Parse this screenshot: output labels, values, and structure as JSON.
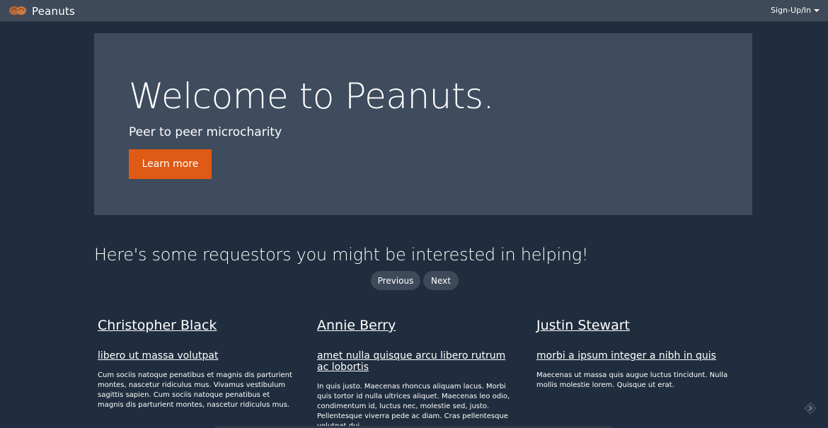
{
  "navbar": {
    "brand_name": "Peanuts",
    "logo_icon": "peanut-icon",
    "auth_label": "Sign-Up/In"
  },
  "hero": {
    "title": "Welcome to Peanuts.",
    "subtitle": "Peer to peer microcharity",
    "button_label": "Learn more"
  },
  "requestors": {
    "heading": "Here's some requestors you might be interested in helping!",
    "previous_label": "Previous",
    "next_label": "Next",
    "cards": [
      {
        "name": "Christopher Black",
        "title": "libero ut massa volutpat",
        "description": "Cum sociis natoque penatibus et magnis dis parturient montes, nascetur ridiculus mus. Vivamus vestibulum sagittis sapien. Cum sociis natoque penatibus et magnis dis parturient montes, nascetur ridiculus mus."
      },
      {
        "name": "Annie Berry",
        "title": "amet nulla quisque arcu libero rutrum ac lobortis",
        "description": "In quis justo. Maecenas rhoncus aliquam lacus. Morbi quis tortor id nulla ultrices aliquet. Maecenas leo odio, condimentum id, luctus nec, molestie sed, justo. Pellentesque viverra pede ac diam. Cras pellentesque volutpat dui."
      },
      {
        "name": "Justin Stewart",
        "title": "morbi a ipsum integer a nibh in quis",
        "description": "Maecenas ut massa quis augue luctus tincidunt. Nulla mollis molestie lorem. Quisque ut erat."
      }
    ]
  },
  "colors": {
    "background": "#1f2d3e",
    "navbar": "#3e4a59",
    "hero": "#3e4c5e",
    "accent": "#df5a14"
  }
}
